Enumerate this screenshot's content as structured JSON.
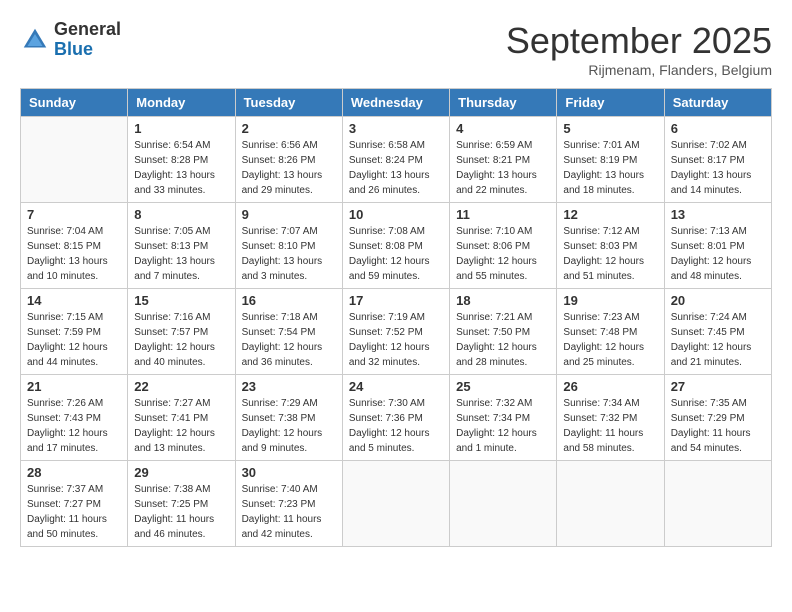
{
  "header": {
    "logo": {
      "general": "General",
      "blue": "Blue"
    },
    "title": "September 2025",
    "subtitle": "Rijmenam, Flanders, Belgium"
  },
  "weekdays": [
    "Sunday",
    "Monday",
    "Tuesday",
    "Wednesday",
    "Thursday",
    "Friday",
    "Saturday"
  ],
  "weeks": [
    [
      {
        "day": "",
        "info": ""
      },
      {
        "day": "1",
        "info": "Sunrise: 6:54 AM\nSunset: 8:28 PM\nDaylight: 13 hours\nand 33 minutes."
      },
      {
        "day": "2",
        "info": "Sunrise: 6:56 AM\nSunset: 8:26 PM\nDaylight: 13 hours\nand 29 minutes."
      },
      {
        "day": "3",
        "info": "Sunrise: 6:58 AM\nSunset: 8:24 PM\nDaylight: 13 hours\nand 26 minutes."
      },
      {
        "day": "4",
        "info": "Sunrise: 6:59 AM\nSunset: 8:21 PM\nDaylight: 13 hours\nand 22 minutes."
      },
      {
        "day": "5",
        "info": "Sunrise: 7:01 AM\nSunset: 8:19 PM\nDaylight: 13 hours\nand 18 minutes."
      },
      {
        "day": "6",
        "info": "Sunrise: 7:02 AM\nSunset: 8:17 PM\nDaylight: 13 hours\nand 14 minutes."
      }
    ],
    [
      {
        "day": "7",
        "info": "Sunrise: 7:04 AM\nSunset: 8:15 PM\nDaylight: 13 hours\nand 10 minutes."
      },
      {
        "day": "8",
        "info": "Sunrise: 7:05 AM\nSunset: 8:13 PM\nDaylight: 13 hours\nand 7 minutes."
      },
      {
        "day": "9",
        "info": "Sunrise: 7:07 AM\nSunset: 8:10 PM\nDaylight: 13 hours\nand 3 minutes."
      },
      {
        "day": "10",
        "info": "Sunrise: 7:08 AM\nSunset: 8:08 PM\nDaylight: 12 hours\nand 59 minutes."
      },
      {
        "day": "11",
        "info": "Sunrise: 7:10 AM\nSunset: 8:06 PM\nDaylight: 12 hours\nand 55 minutes."
      },
      {
        "day": "12",
        "info": "Sunrise: 7:12 AM\nSunset: 8:03 PM\nDaylight: 12 hours\nand 51 minutes."
      },
      {
        "day": "13",
        "info": "Sunrise: 7:13 AM\nSunset: 8:01 PM\nDaylight: 12 hours\nand 48 minutes."
      }
    ],
    [
      {
        "day": "14",
        "info": "Sunrise: 7:15 AM\nSunset: 7:59 PM\nDaylight: 12 hours\nand 44 minutes."
      },
      {
        "day": "15",
        "info": "Sunrise: 7:16 AM\nSunset: 7:57 PM\nDaylight: 12 hours\nand 40 minutes."
      },
      {
        "day": "16",
        "info": "Sunrise: 7:18 AM\nSunset: 7:54 PM\nDaylight: 12 hours\nand 36 minutes."
      },
      {
        "day": "17",
        "info": "Sunrise: 7:19 AM\nSunset: 7:52 PM\nDaylight: 12 hours\nand 32 minutes."
      },
      {
        "day": "18",
        "info": "Sunrise: 7:21 AM\nSunset: 7:50 PM\nDaylight: 12 hours\nand 28 minutes."
      },
      {
        "day": "19",
        "info": "Sunrise: 7:23 AM\nSunset: 7:48 PM\nDaylight: 12 hours\nand 25 minutes."
      },
      {
        "day": "20",
        "info": "Sunrise: 7:24 AM\nSunset: 7:45 PM\nDaylight: 12 hours\nand 21 minutes."
      }
    ],
    [
      {
        "day": "21",
        "info": "Sunrise: 7:26 AM\nSunset: 7:43 PM\nDaylight: 12 hours\nand 17 minutes."
      },
      {
        "day": "22",
        "info": "Sunrise: 7:27 AM\nSunset: 7:41 PM\nDaylight: 12 hours\nand 13 minutes."
      },
      {
        "day": "23",
        "info": "Sunrise: 7:29 AM\nSunset: 7:38 PM\nDaylight: 12 hours\nand 9 minutes."
      },
      {
        "day": "24",
        "info": "Sunrise: 7:30 AM\nSunset: 7:36 PM\nDaylight: 12 hours\nand 5 minutes."
      },
      {
        "day": "25",
        "info": "Sunrise: 7:32 AM\nSunset: 7:34 PM\nDaylight: 12 hours\nand 1 minute."
      },
      {
        "day": "26",
        "info": "Sunrise: 7:34 AM\nSunset: 7:32 PM\nDaylight: 11 hours\nand 58 minutes."
      },
      {
        "day": "27",
        "info": "Sunrise: 7:35 AM\nSunset: 7:29 PM\nDaylight: 11 hours\nand 54 minutes."
      }
    ],
    [
      {
        "day": "28",
        "info": "Sunrise: 7:37 AM\nSunset: 7:27 PM\nDaylight: 11 hours\nand 50 minutes."
      },
      {
        "day": "29",
        "info": "Sunrise: 7:38 AM\nSunset: 7:25 PM\nDaylight: 11 hours\nand 46 minutes."
      },
      {
        "day": "30",
        "info": "Sunrise: 7:40 AM\nSunset: 7:23 PM\nDaylight: 11 hours\nand 42 minutes."
      },
      {
        "day": "",
        "info": ""
      },
      {
        "day": "",
        "info": ""
      },
      {
        "day": "",
        "info": ""
      },
      {
        "day": "",
        "info": ""
      }
    ]
  ]
}
